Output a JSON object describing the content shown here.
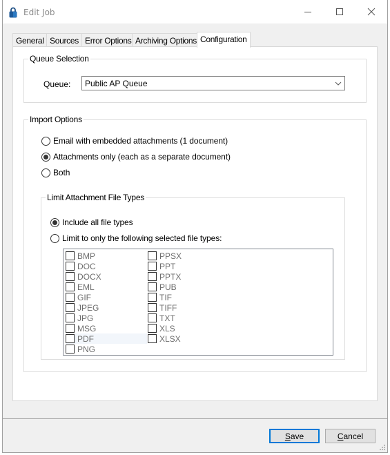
{
  "window": {
    "title": "Edit Job",
    "app_icon": "padlock-icon",
    "controls": {
      "minimize": "minimize-icon",
      "maximize": "maximize-icon",
      "close": "close-icon"
    }
  },
  "tabs": [
    {
      "label": "General",
      "active": false
    },
    {
      "label": "Sources",
      "active": false
    },
    {
      "label": "Error Options",
      "active": false
    },
    {
      "label": "Archiving Options",
      "active": false
    },
    {
      "label": "Configuration",
      "active": true
    }
  ],
  "queue_selection": {
    "group_label": "Queue Selection",
    "queue_label": "Queue:",
    "queue_value": "Public AP Queue"
  },
  "import_options": {
    "group_label": "Import Options",
    "options": [
      {
        "label": "Email with embedded attachments (1 document)",
        "selected": false
      },
      {
        "label": "Attachments only (each as a separate document)",
        "selected": true
      },
      {
        "label": "Both",
        "selected": false
      }
    ]
  },
  "limit_file_types": {
    "group_label": "Limit Attachment File Types",
    "options": [
      {
        "label": "Include all file types",
        "selected": true
      },
      {
        "label": "Limit to only the following selected file types:",
        "selected": false
      }
    ],
    "file_types_col1": [
      "BMP",
      "DOC",
      "DOCX",
      "EML",
      "GIF",
      "JPEG",
      "JPG",
      "MSG",
      "PDF",
      "PNG"
    ],
    "file_types_col2": [
      "PPSX",
      "PPT",
      "PPTX",
      "PUB",
      "TIF",
      "TIFF",
      "TXT",
      "XLS",
      "XLSX"
    ],
    "highlighted_item": "PDF"
  },
  "buttons": {
    "save": {
      "mnemonic": "S",
      "rest": "ave"
    },
    "cancel": {
      "mnemonic": "C",
      "rest": "ancel"
    }
  },
  "colors": {
    "default_button_border": "#0078d7",
    "disabled_text": "#6d6d6d",
    "dialog_bg": "#f0f0f0"
  }
}
